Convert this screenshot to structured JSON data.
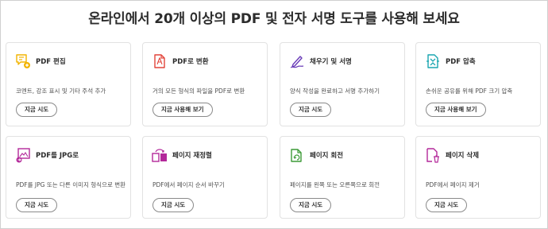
{
  "heading": "온라인에서 20개 이상의 PDF 및 전자 서명 도구를 사용해 보세요",
  "cards": [
    {
      "title": "PDF 편집",
      "desc": "코멘트, 강조 표시 및 기타 주석 추가",
      "button": "지금 시도",
      "icon": "edit-pdf-icon"
    },
    {
      "title": "PDF로 변환",
      "desc": "거의 모든 형식의 파일을 PDF로 변환",
      "button": "지금 사용해 보기",
      "icon": "convert-to-pdf-icon"
    },
    {
      "title": "채우기 및 서명",
      "desc": "양식 작성을 완료하고 서명 추가하기",
      "button": "지금 시도",
      "icon": "fill-sign-icon"
    },
    {
      "title": "PDF 압축",
      "desc": "손쉬운 공유를 위해 PDF 크기 압축",
      "button": "지금 사용해 보기",
      "icon": "compress-pdf-icon"
    },
    {
      "title": "PDF를 JPG로",
      "desc": "PDF를 JPG 또는 다른 이미지 형식으로 변환",
      "button": "지금 시도",
      "icon": "pdf-to-jpg-icon"
    },
    {
      "title": "페이지 재정렬",
      "desc": "PDF에서 페이지 순서 바꾸기",
      "button": "지금 시도",
      "icon": "reorder-pages-icon"
    },
    {
      "title": "페이지 회전",
      "desc": "페이지를 왼쪽 또는 오른쪽으로 회전",
      "button": "지금 시도",
      "icon": "rotate-pages-icon"
    },
    {
      "title": "페이지 삭제",
      "desc": "PDF에서 페이지 제거",
      "button": "지금 시도",
      "icon": "delete-pages-icon"
    }
  ],
  "colors": {
    "edit": "#f2b400",
    "acrobat_red": "#e2443a",
    "sign_purple": "#6a3db8",
    "compress_teal": "#1aa6b0",
    "organize_magenta": "#b3289a",
    "rotate_green": "#3c9a36"
  }
}
